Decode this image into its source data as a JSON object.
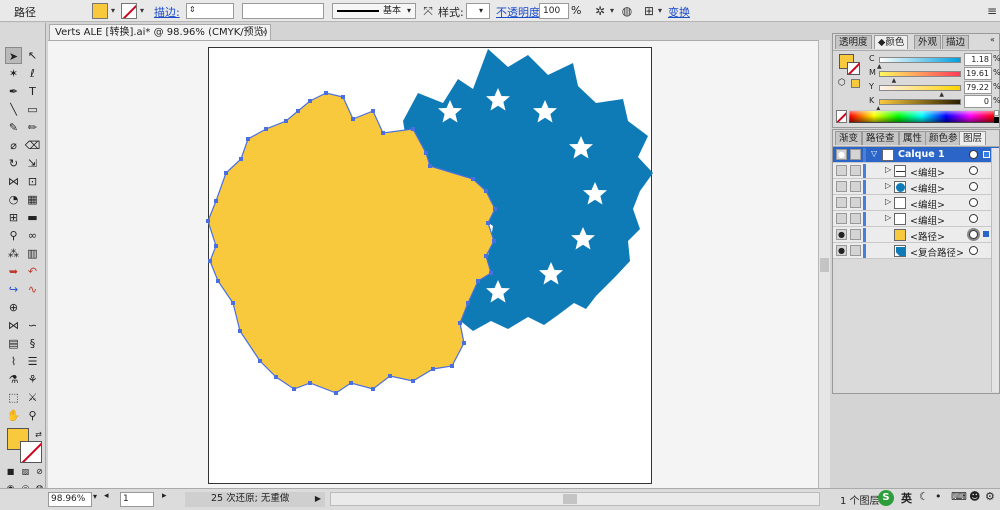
{
  "control_bar": {
    "object_type": "路径",
    "stroke_label": "描边:",
    "stroke_weight": "",
    "profile_label": "基本",
    "style_label": "样式:",
    "opacity_label": "不透明度:",
    "opacity_value": "100",
    "opacity_unit": "%",
    "transform_label": "变换"
  },
  "document": {
    "tab_title": "Verts ALE [转换].ai* @ 98.96% (CMYK/预览)",
    "close_glyph": "✕"
  },
  "status_bar": {
    "zoom": "98.96%",
    "artboard_number": "1",
    "status_text": "25 次还原; 无重做",
    "layer_count": "1 个图层"
  },
  "color_panel": {
    "tabs": [
      "透明度",
      "颜色",
      "外观",
      "描边"
    ],
    "active_tab": "颜色",
    "sliders": [
      {
        "channel": "C",
        "value": "1.18",
        "unit": "%",
        "level": 0.012
      },
      {
        "channel": "M",
        "value": "19.61",
        "unit": "%",
        "level": 0.196
      },
      {
        "channel": "Y",
        "value": "79.22",
        "unit": "%",
        "level": 0.792
      },
      {
        "channel": "K",
        "value": "0",
        "unit": "%",
        "level": 0.0
      }
    ],
    "fill_color": "#f9c93d"
  },
  "layers_panel": {
    "tabs": [
      "渐变",
      "路径查",
      "属性",
      "颜色参",
      "图层"
    ],
    "active_tab": "图层",
    "top_layer": "Calque 1",
    "items": [
      {
        "name": "<编组>",
        "visible": false
      },
      {
        "name": "<编组>",
        "visible": false
      },
      {
        "name": "<编组>",
        "visible": false
      },
      {
        "name": "<编组>",
        "visible": false
      },
      {
        "name": "<路径>",
        "visible": true
      },
      {
        "name": "<复合路径>",
        "visible": true
      }
    ]
  },
  "taskbar": {
    "ime_label": "英"
  },
  "colors": {
    "yellow_shape": "#f9c93d",
    "blue_shape": "#0e7bb7",
    "selection": "#4a6fe0"
  }
}
